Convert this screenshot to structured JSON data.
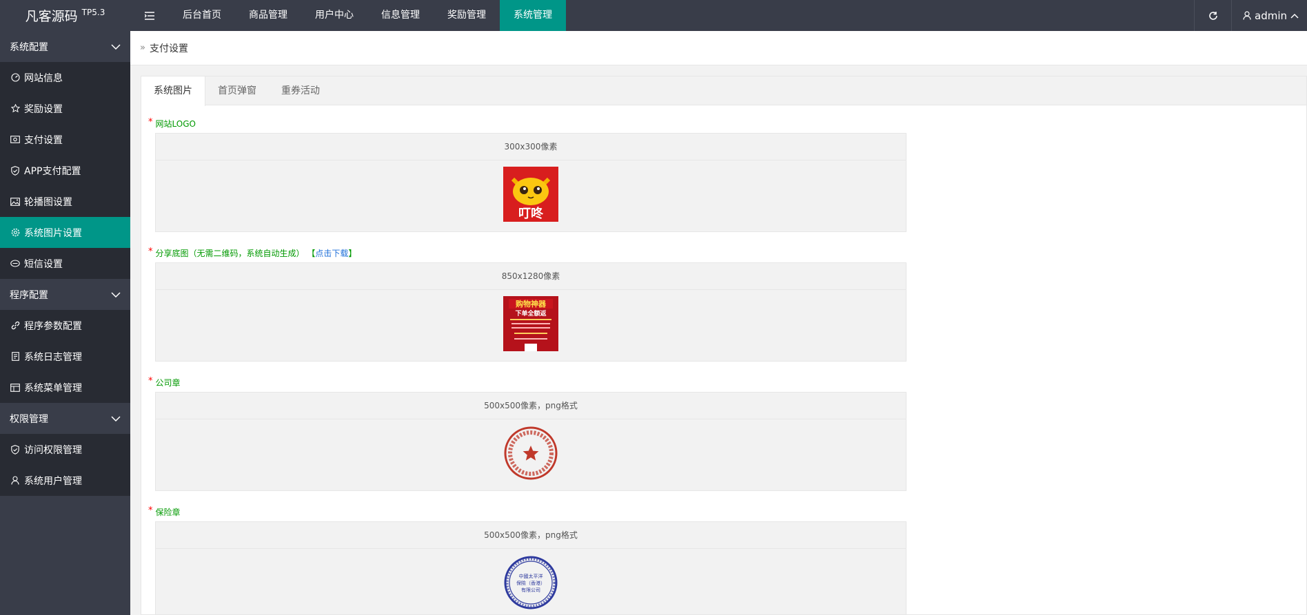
{
  "header": {
    "brand": "凡客源码",
    "version": "TP5.3",
    "nav": [
      "后台首页",
      "商品管理",
      "用户中心",
      "信息管理",
      "奖励管理",
      "系统管理"
    ],
    "active_nav": "系统管理",
    "user": "admin"
  },
  "sidebar": {
    "groups": [
      {
        "label": "系统配置",
        "items": [
          {
            "label": "网站信息",
            "icon": "gauge-icon"
          },
          {
            "label": "奖励设置",
            "icon": "star-icon"
          },
          {
            "label": "支付设置",
            "icon": "money-icon"
          },
          {
            "label": "APP支付配置",
            "icon": "shield-icon"
          },
          {
            "label": "轮播图设置",
            "icon": "image-icon"
          },
          {
            "label": "系统图片设置",
            "icon": "gear-icon"
          },
          {
            "label": "短信设置",
            "icon": "message-icon"
          }
        ]
      },
      {
        "label": "程序配置",
        "items": [
          {
            "label": "程序参数配置",
            "icon": "link-icon"
          },
          {
            "label": "系统日志管理",
            "icon": "log-icon"
          },
          {
            "label": "系统菜单管理",
            "icon": "menu-icon"
          }
        ]
      },
      {
        "label": "权限管理",
        "items": [
          {
            "label": "访问权限管理",
            "icon": "shield-icon"
          },
          {
            "label": "系统用户管理",
            "icon": "user-icon"
          }
        ]
      }
    ],
    "active_item": "系统图片设置"
  },
  "breadcrumb": {
    "current": "支付设置"
  },
  "tabs": [
    "系统图片",
    "首页弹窗",
    "重券活动"
  ],
  "fields": [
    {
      "required": "*",
      "label": "网站LOGO",
      "size_hint": "300x300像素",
      "image_text": "叮咚"
    },
    {
      "required": "*",
      "label": "分享底图（无需二维码，系统自动生成）",
      "link_open": "【",
      "link": "点击下载",
      "link_close": "】",
      "size_hint": "850x1280像素",
      "image_text_1": "购物神器",
      "image_text_2": "下单全额返"
    },
    {
      "required": "*",
      "label": "公司章",
      "size_hint": "500x500像素，png格式"
    },
    {
      "required": "*",
      "label": "保险章",
      "size_hint": "500x500像素，png格式",
      "image_text_1": "中國太平洋",
      "image_text_2": "保險（香港）",
      "image_text_3": "有限公司"
    }
  ],
  "colors": {
    "header_bg": "#393d49",
    "accent": "#009688",
    "sidebar_item_bg": "#282b33",
    "label_green": "#009900"
  }
}
